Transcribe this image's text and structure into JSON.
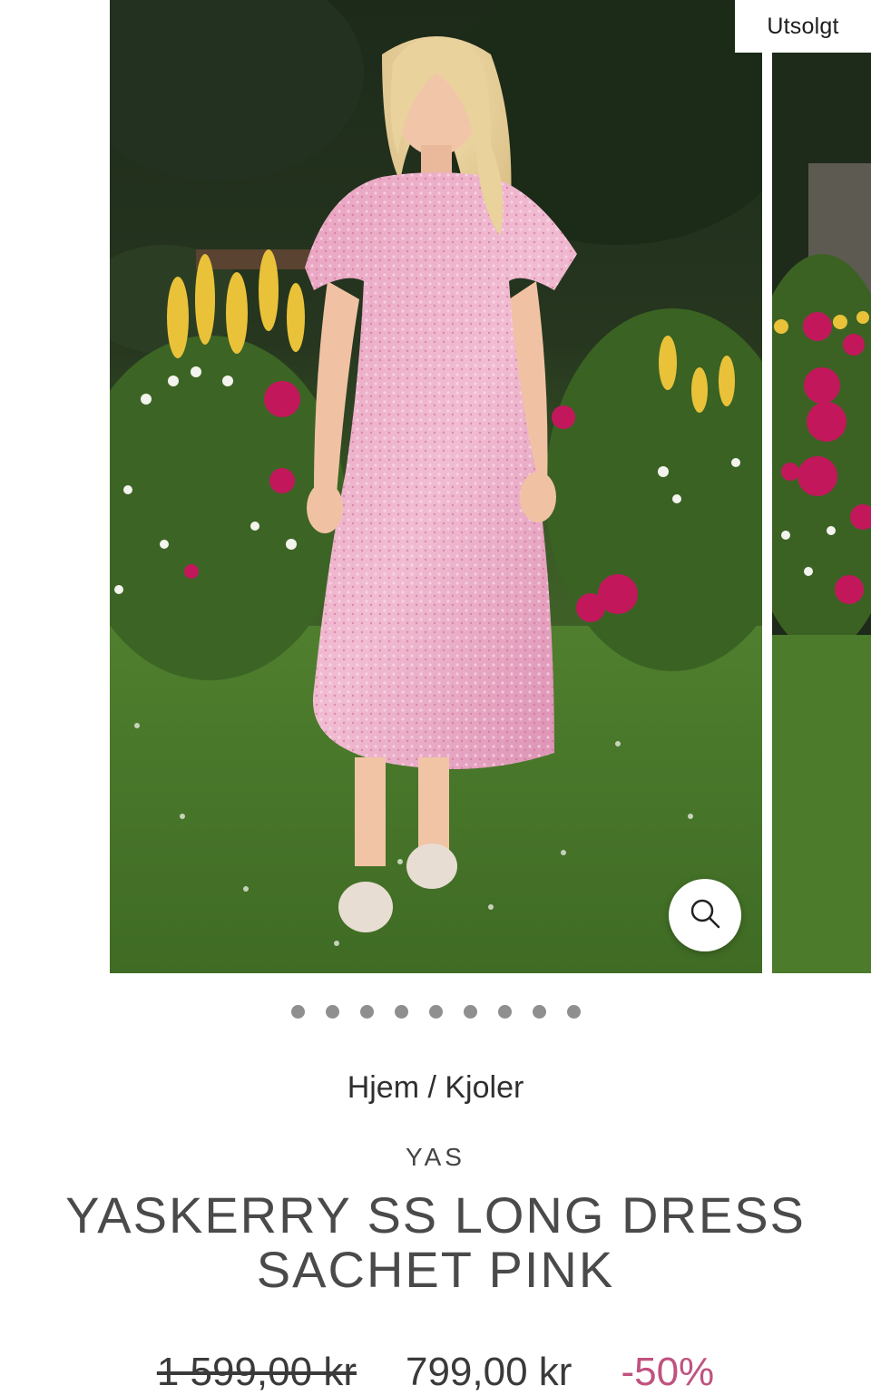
{
  "gallery": {
    "badge_label": "Utsolgt",
    "dot_count": 9,
    "zoom_icon": "search-icon"
  },
  "breadcrumb": {
    "home": "Hjem",
    "separator": " / ",
    "category": "Kjoler"
  },
  "product": {
    "brand": "YAS",
    "title_line1": "YASKERRY SS LONG DRESS",
    "title_line2": "SACHET PINK",
    "price_original": "1 599,00 kr",
    "price_sale": "799,00 kr",
    "discount": "-50%"
  },
  "colors": {
    "discount": "#c0527f",
    "dot": "#8f8f8f"
  }
}
